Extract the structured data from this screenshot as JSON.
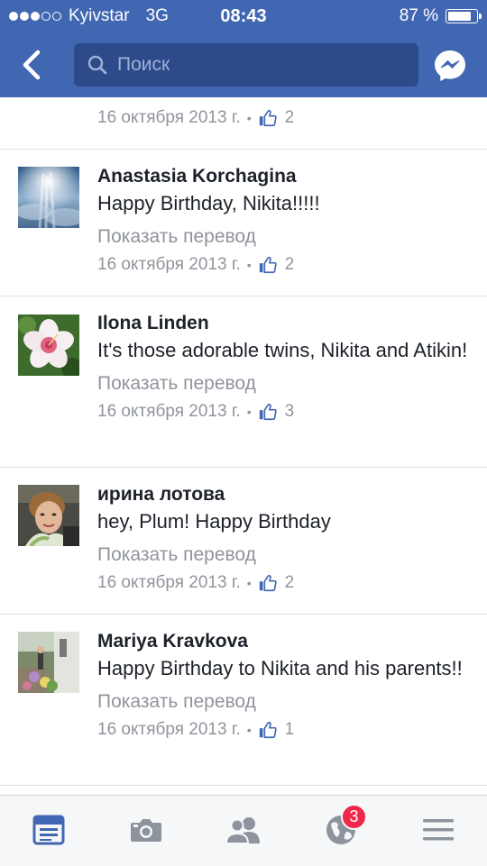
{
  "status_bar": {
    "carrier": "Kyivstar",
    "network": "3G",
    "time": "08:43",
    "battery": "87 %",
    "battery_level": 0.87,
    "signal_bars": 3,
    "signal_total": 5
  },
  "nav": {
    "back_icon": "chevron-left-icon",
    "search_placeholder": "Поиск",
    "messenger_icon": "messenger-icon"
  },
  "feed": {
    "top_partial": {
      "date": "16 октября 2013 г.",
      "likes": "2"
    },
    "comments": [
      {
        "name": "Anastasia Korchagina",
        "text": "Happy Birthday, Nikita!!!!!",
        "translate": "Показать перевод",
        "date": "16 октября 2013 г.",
        "likes": "2"
      },
      {
        "name": "Ilona Linden",
        "text": "It's those adorable twins, Nikita and Atikin!",
        "translate": "Показать перевод",
        "date": "16 октября 2013 г.",
        "likes": "3"
      },
      {
        "name": "ирина лотова",
        "text": "hey, Plum! Happy Birthday",
        "translate": "Показать перевод",
        "date": "16 октября 2013 г.",
        "likes": "2"
      },
      {
        "name": "Mariya Kravkova",
        "text": "Happy Birthday to Nikita and his parents!!",
        "translate": "Показать перевод",
        "date": "16 октября 2013 г.",
        "likes": "1"
      }
    ]
  },
  "tab_bar": {
    "tabs": [
      {
        "icon": "news-feed-icon",
        "active": true
      },
      {
        "icon": "camera-icon"
      },
      {
        "icon": "friends-icon"
      },
      {
        "icon": "globe-notifications-icon",
        "badge": "3"
      },
      {
        "icon": "menu-icon"
      }
    ]
  },
  "colors": {
    "header": "#4267b2",
    "search_bg": "#2d4a8a",
    "active_tab": "#4267b2",
    "inactive_tab": "#8d949e",
    "badge": "#f02849",
    "meta_text": "#90949c"
  }
}
